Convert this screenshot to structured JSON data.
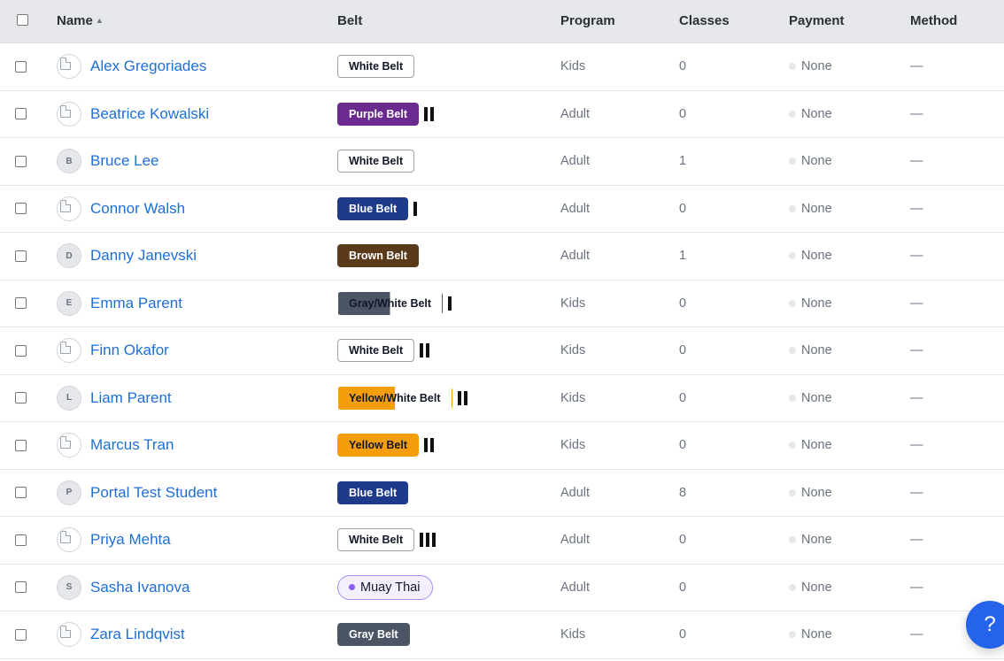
{
  "columns": {
    "name": "Name",
    "belt": "Belt",
    "program": "Program",
    "classes": "Classes",
    "payment": "Payment",
    "method": "Method",
    "sort_indicator": "▲"
  },
  "belt_colors": {
    "white": "#ffffff",
    "purple": "#6b2a8f",
    "blue": "#1e3a8a",
    "brown": "#5b3a1a",
    "gray": "#4b5563",
    "yellow": "#f59e0b"
  },
  "rows": [
    {
      "name": "Alex Gregoriades",
      "avatar_type": "image",
      "initial": "",
      "belt": "White Belt",
      "belt_style": "white",
      "stripes": 0,
      "program": "Kids",
      "classes": "0",
      "payment": "None",
      "method": "—"
    },
    {
      "name": "Beatrice Kowalski",
      "avatar_type": "image",
      "initial": "",
      "belt": "Purple Belt",
      "belt_style": "purple",
      "stripes": 2,
      "program": "Adult",
      "classes": "0",
      "payment": "None",
      "method": "—"
    },
    {
      "name": "Bruce Lee",
      "avatar_type": "initial",
      "initial": "B",
      "belt": "White Belt",
      "belt_style": "white",
      "stripes": 0,
      "program": "Adult",
      "classes": "1",
      "payment": "None",
      "method": "—"
    },
    {
      "name": "Connor Walsh",
      "avatar_type": "image",
      "initial": "",
      "belt": "Blue Belt",
      "belt_style": "blue",
      "stripes": 1,
      "program": "Adult",
      "classes": "0",
      "payment": "None",
      "method": "—"
    },
    {
      "name": "Danny Janevski",
      "avatar_type": "initial",
      "initial": "D",
      "belt": "Brown Belt",
      "belt_style": "brown",
      "stripes": 0,
      "program": "Adult",
      "classes": "1",
      "payment": "None",
      "method": "—"
    },
    {
      "name": "Emma Parent",
      "avatar_type": "initial",
      "initial": "E",
      "belt": "Gray/White Belt",
      "belt_style": "gray-white",
      "stripes": 1,
      "program": "Kids",
      "classes": "0",
      "payment": "None",
      "method": "—"
    },
    {
      "name": "Finn Okafor",
      "avatar_type": "image",
      "initial": "",
      "belt": "White Belt",
      "belt_style": "white",
      "stripes": 2,
      "program": "Kids",
      "classes": "0",
      "payment": "None",
      "method": "—"
    },
    {
      "name": "Liam Parent",
      "avatar_type": "initial",
      "initial": "L",
      "belt": "Yellow/White Belt",
      "belt_style": "yellow-white",
      "stripes": 2,
      "program": "Kids",
      "classes": "0",
      "payment": "None",
      "method": "—"
    },
    {
      "name": "Marcus Tran",
      "avatar_type": "image",
      "initial": "",
      "belt": "Yellow Belt",
      "belt_style": "yellow",
      "stripes": 2,
      "program": "Kids",
      "classes": "0",
      "payment": "None",
      "method": "—"
    },
    {
      "name": "Portal Test Student",
      "avatar_type": "initial",
      "initial": "P",
      "belt": "Blue Belt",
      "belt_style": "blue",
      "stripes": 0,
      "program": "Adult",
      "classes": "8",
      "payment": "None",
      "method": "—"
    },
    {
      "name": "Priya Mehta",
      "avatar_type": "image",
      "initial": "",
      "belt": "White Belt",
      "belt_style": "white",
      "stripes": 3,
      "program": "Adult",
      "classes": "0",
      "payment": "None",
      "method": "—"
    },
    {
      "name": "Sasha Ivanova",
      "avatar_type": "initial",
      "initial": "S",
      "belt": "Muay Thai",
      "belt_style": "muay-thai",
      "stripes": 0,
      "program": "Adult",
      "classes": "0",
      "payment": "None",
      "method": "—"
    },
    {
      "name": "Zara Lindqvist",
      "avatar_type": "image",
      "initial": "",
      "belt": "Gray Belt",
      "belt_style": "gray",
      "stripes": 0,
      "program": "Kids",
      "classes": "0",
      "payment": "None",
      "method": "—"
    }
  ],
  "help_button": {
    "label": "?"
  }
}
